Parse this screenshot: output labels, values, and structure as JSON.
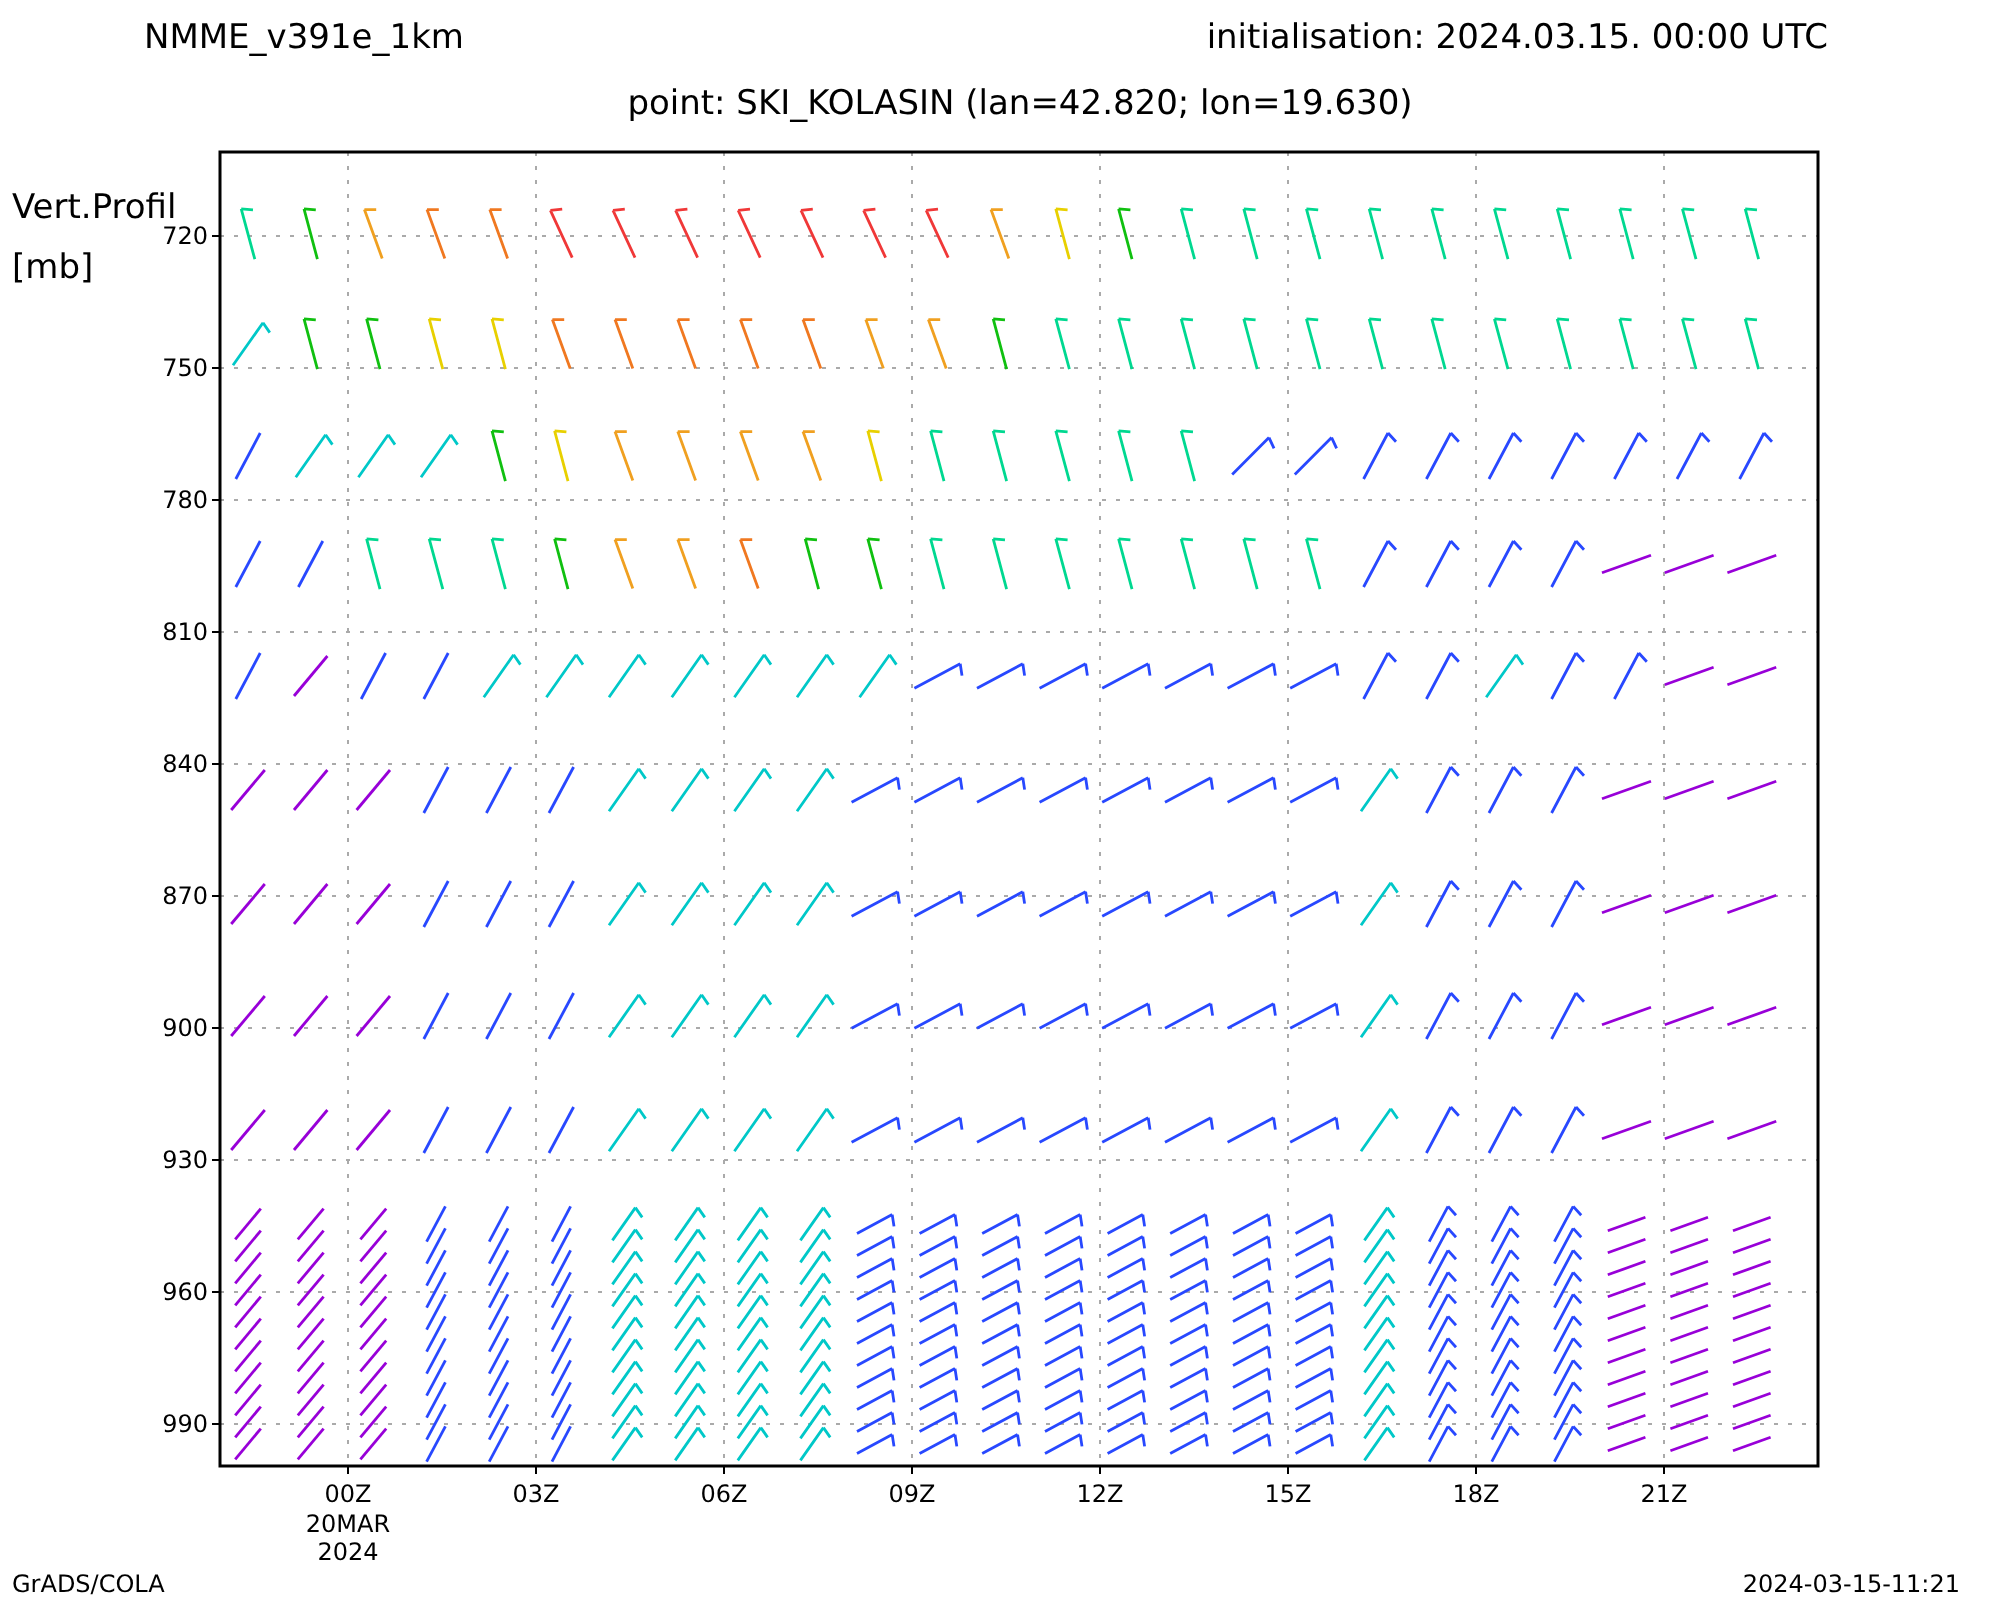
{
  "header": {
    "model": "NMME_v391e_1km",
    "initialisation": "initialisation: 2024.03.15. 00:00 UTC",
    "point": "point: SKI_KOLASIN (lan=42.820; lon=19.630)"
  },
  "y_axis": {
    "title": "Vert.Profil",
    "unit": "[mb]",
    "ticks": [
      "720",
      "750",
      "780",
      "810",
      "840",
      "870",
      "900",
      "930",
      "960",
      "990"
    ]
  },
  "x_axis": {
    "ticks": [
      {
        "label": "00Z",
        "sub": [
          "20MAR",
          "2024"
        ]
      },
      {
        "label": "03Z"
      },
      {
        "label": "06Z"
      },
      {
        "label": "09Z"
      },
      {
        "label": "12Z"
      },
      {
        "label": "15Z"
      },
      {
        "label": "18Z"
      },
      {
        "label": "21Z"
      }
    ]
  },
  "footer": {
    "left": "GrADS/COLA",
    "right": "2024-03-15-11:21"
  }
}
